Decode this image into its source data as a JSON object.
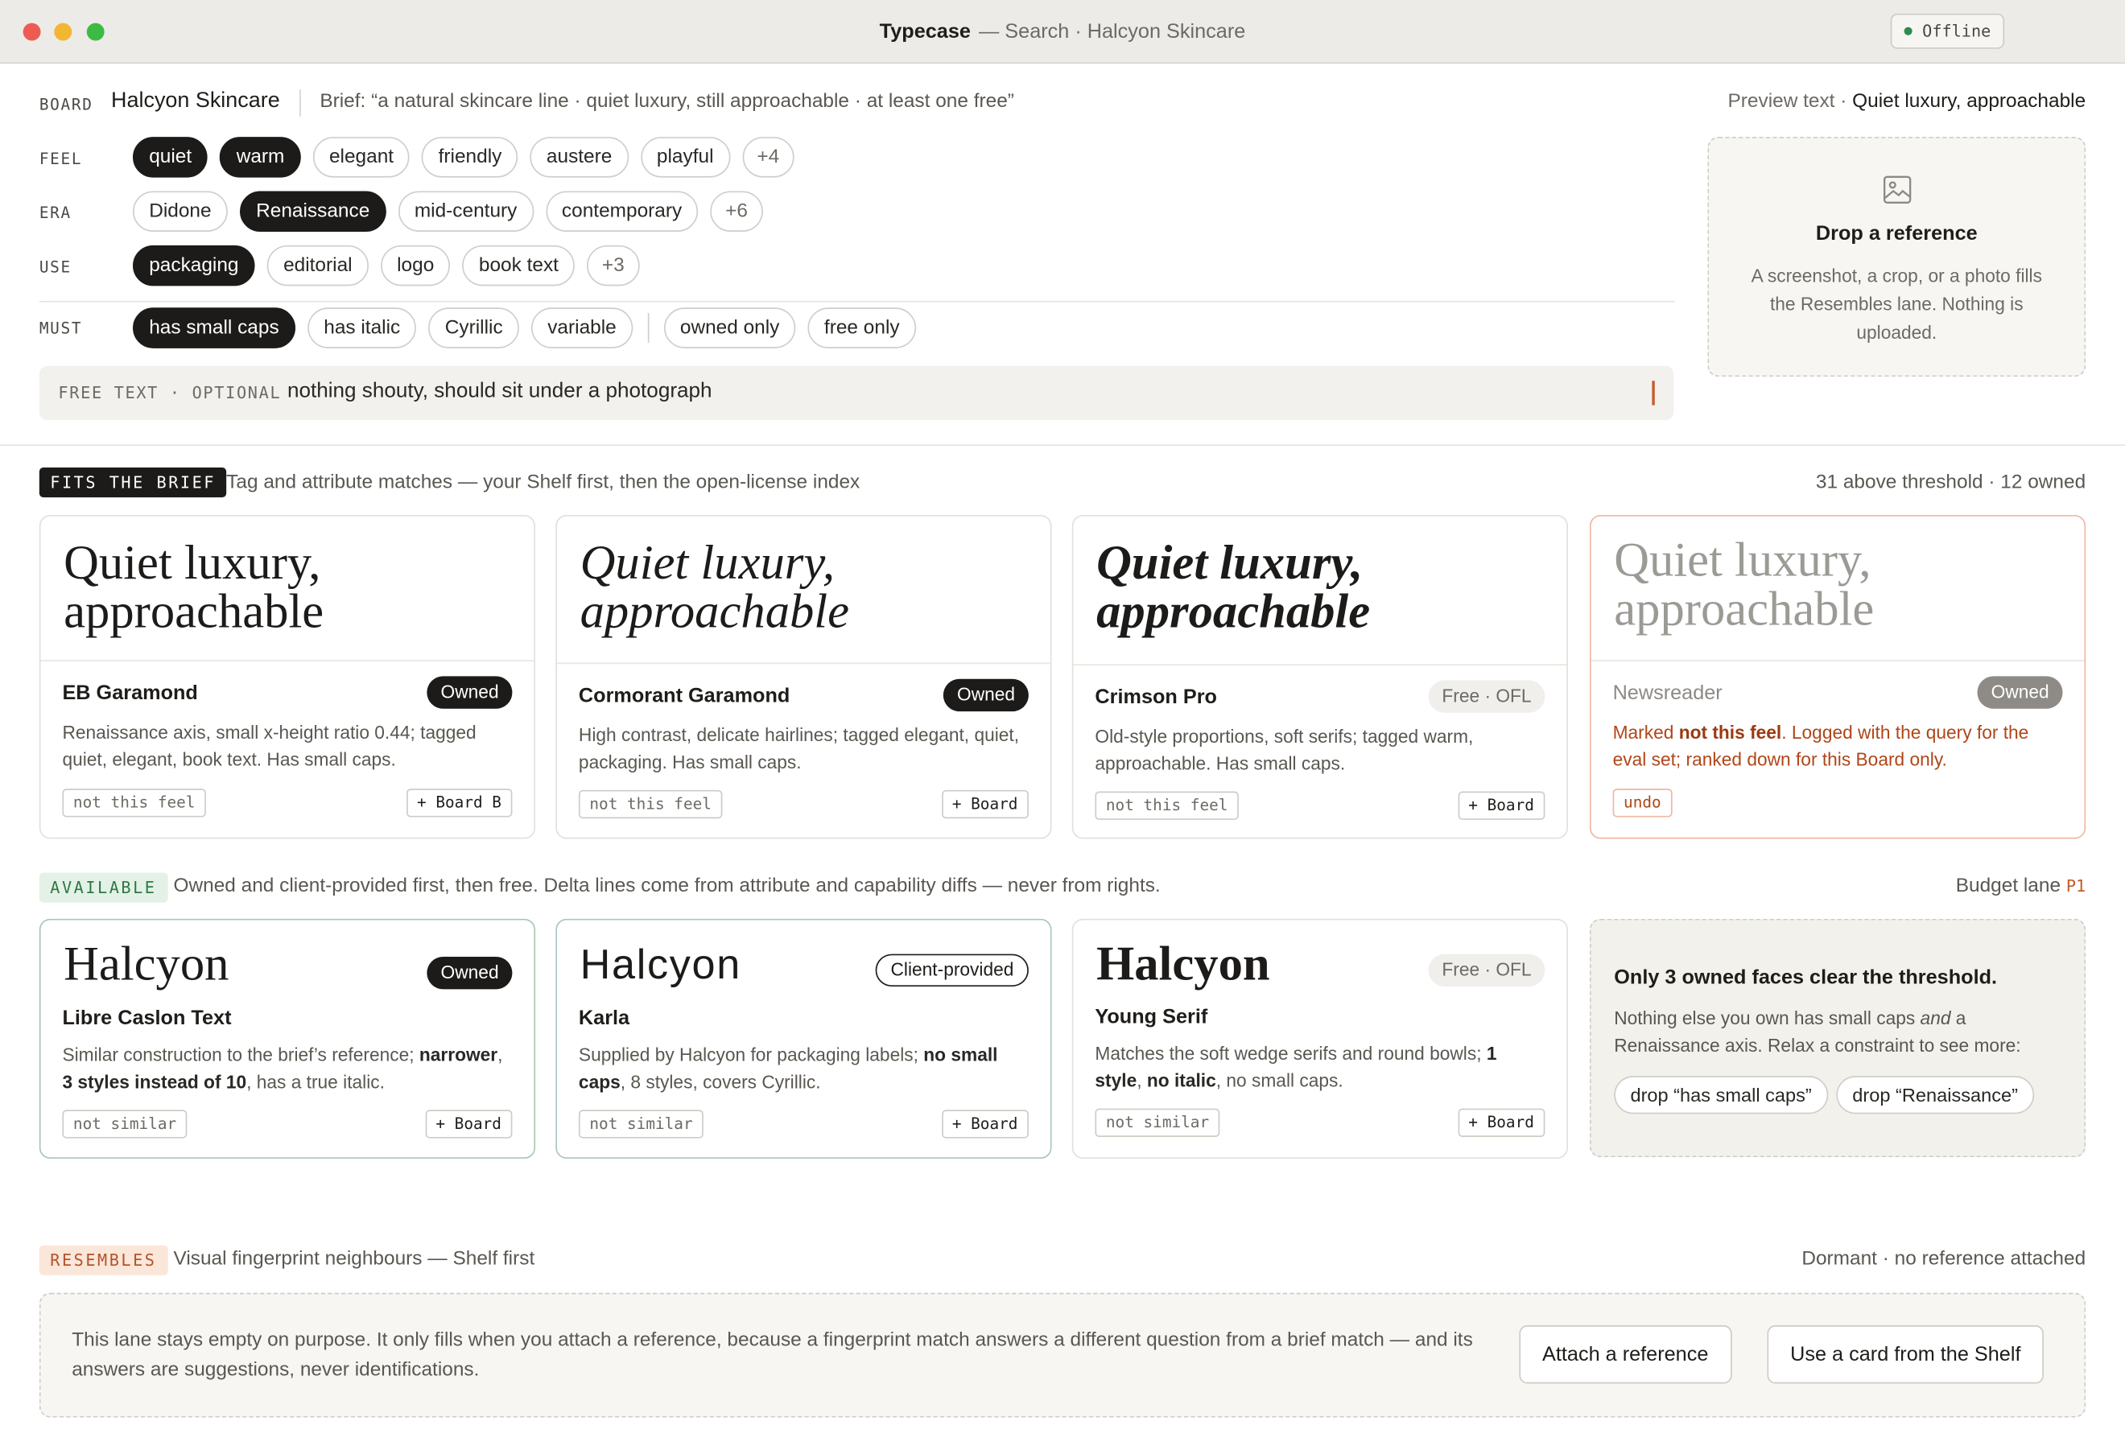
{
  "window": {
    "app_name": "Typecase",
    "title_rest": "— Search · Halcyon Skincare",
    "status": "Offline"
  },
  "brief": {
    "board_label": "BOARD",
    "board_name": "Halcyon Skincare",
    "brief_text": "Brief: “a natural skincare line · quiet luxury, still approachable · at least one free”",
    "preview_label": "Preview text ·",
    "preview_value": "Quiet luxury, approachable",
    "rows": {
      "feel": {
        "label": "FEEL",
        "chips": [
          {
            "t": "quiet",
            "on": true
          },
          {
            "t": "warm",
            "on": true
          },
          {
            "t": "elegant",
            "on": false
          },
          {
            "t": "friendly",
            "on": false
          },
          {
            "t": "austere",
            "on": false
          },
          {
            "t": "playful",
            "on": false
          }
        ],
        "more": "+4"
      },
      "era": {
        "label": "ERA",
        "chips": [
          {
            "t": "Didone",
            "on": false
          },
          {
            "t": "Renaissance",
            "on": true
          },
          {
            "t": "mid-century",
            "on": false
          },
          {
            "t": "contemporary",
            "on": false
          }
        ],
        "more": "+6"
      },
      "use": {
        "label": "USE",
        "chips": [
          {
            "t": "packaging",
            "on": true
          },
          {
            "t": "editorial",
            "on": false
          },
          {
            "t": "logo",
            "on": false
          },
          {
            "t": "book text",
            "on": false
          }
        ],
        "more": "+3"
      },
      "must": {
        "label": "MUST",
        "chips": [
          {
            "t": "has small caps",
            "on": true
          },
          {
            "t": "has italic",
            "on": false
          },
          {
            "t": "Cyrillic",
            "on": false
          },
          {
            "t": "variable",
            "on": false
          }
        ],
        "rights": [
          "owned only",
          "free only"
        ]
      }
    },
    "free_text_label": "FREE TEXT · OPTIONAL",
    "free_text_value": "nothing shouty, should sit under a photograph",
    "drop": {
      "icon": "image-icon",
      "title": "Drop a reference",
      "text": "A screenshot, a crop, or a photo fills the Resembles lane. Nothing is uploaded."
    }
  },
  "fits": {
    "badge": "FITS THE BRIEF",
    "desc": "Tag and attribute matches — your Shelf first, then the open-license index",
    "summary": "31 above threshold · 12 owned",
    "cards": [
      {
        "specimen1": "Quiet luxury,",
        "specimen2": "approachable",
        "name": "EB Garamond",
        "tag": "Owned",
        "desc": "Renaissance axis, small x-height ratio 0.44; tagged quiet, elegant, book text. Has small caps.",
        "left_btn": "not this feel",
        "right_btn": "+ Board B"
      },
      {
        "specimen1": "Quiet luxury,",
        "specimen2": "approachable",
        "name": "Cormorant Garamond",
        "tag": "Owned",
        "desc": "High contrast, delicate hairlines; tagged elegant, quiet, packaging. Has small caps.",
        "left_btn": "not this feel",
        "right_btn": "+ Board"
      },
      {
        "specimen1": "Quiet luxury,",
        "specimen2": "approachable",
        "name": "Crimson Pro",
        "tag": "Free · OFL",
        "desc": "Old-style proportions, soft serifs; tagged warm, approachable. Has small caps.",
        "left_btn": "not this feel",
        "right_btn": "+ Board"
      },
      {
        "specimen1": "Quiet luxury,",
        "specimen2": "approachable",
        "name": "Newsreader",
        "tag": "Owned",
        "desc_a": "Marked ",
        "desc_b": "not this feel",
        "desc_c": ". Logged with the query for the eval set; ranked down for this Board only.",
        "left_btn": "undo"
      }
    ]
  },
  "available": {
    "badge": "AVAILABLE",
    "desc": "Owned and client-provided first, then free. Delta lines come from attribute and capability diffs — never from rights.",
    "right_label": "Budget lane",
    "right_code": "P1",
    "cards": [
      {
        "specimen": "Halcyon",
        "name": "Libre Caslon Text",
        "tag": "Owned",
        "d1": "Similar construction to the brief’s reference; ",
        "d2": "narrower",
        "d3": ", ",
        "d4": "3 styles instead of 10",
        "d5": ", has a true italic.",
        "left_btn": "not similar",
        "right_btn": "+ Board"
      },
      {
        "specimen": "Halcyon",
        "name": "Karla",
        "tag": "Client-provided",
        "d1": "Supplied by Halcyon for packaging labels; ",
        "d2": "no small caps",
        "d3": ", 8 styles, covers Cyrillic.",
        "left_btn": "not similar",
        "right_btn": "+ Board"
      },
      {
        "specimen": "Halcyon",
        "name": "Young Serif",
        "tag": "Free · OFL",
        "d1": "Matches the soft wedge serifs and round bowls; ",
        "d2": "1 style",
        "d3": ", ",
        "d4": "no italic",
        "d5": ", no small caps.",
        "left_btn": "not similar",
        "right_btn": "+ Board"
      }
    ],
    "threshold": {
      "title": "Only 3 owned faces clear the threshold.",
      "t1": "Nothing else you own has small caps ",
      "t2": "and",
      "t3": " a Renaissance axis. Relax a constraint to see more:",
      "buttons": [
        "drop “has small caps”",
        "drop “Renaissance”"
      ]
    }
  },
  "resembles": {
    "badge": "RESEMBLES",
    "desc": "Visual fingerprint neighbours — Shelf first",
    "status": "Dormant · no reference attached",
    "text": "This lane stays empty on purpose. It only fills when you attach a reference, because a fingerprint match answers a different question from a brief match — and its answers are suggestions, never identifications.",
    "attach_btn": "Attach a reference",
    "shelf_btn": "Use a card from the Shelf"
  }
}
